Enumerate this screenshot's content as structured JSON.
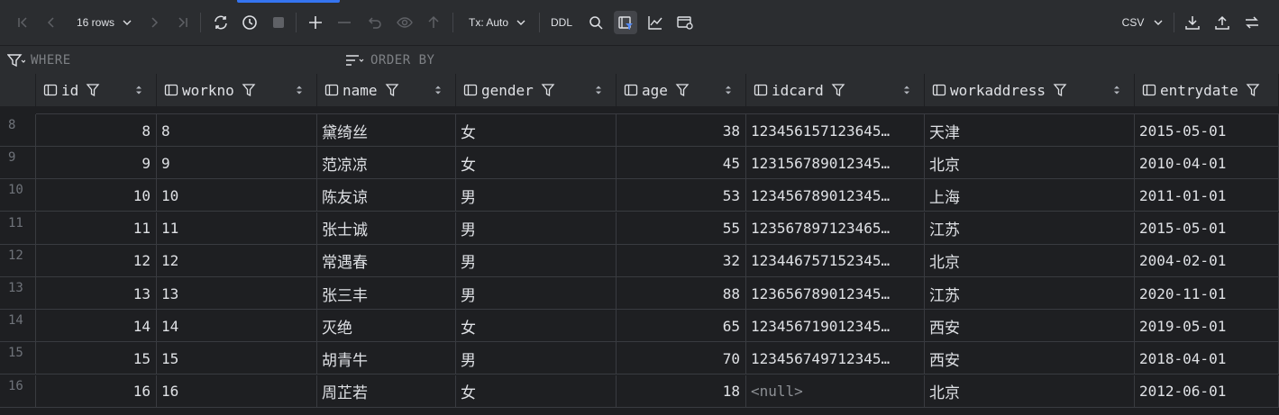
{
  "toolbar": {
    "rows_label": "16 rows",
    "tx_label": "Tx: Auto",
    "ddl_label": "DDL",
    "export_format": "CSV"
  },
  "filter": {
    "where_label": "WHERE",
    "order_label": "ORDER BY"
  },
  "columns": [
    {
      "name": "id"
    },
    {
      "name": "workno"
    },
    {
      "name": "name"
    },
    {
      "name": "gender"
    },
    {
      "name": "age"
    },
    {
      "name": "idcard"
    },
    {
      "name": "workaddress"
    },
    {
      "name": "entrydate"
    }
  ],
  "rows": [
    {
      "num": "8",
      "id": "8",
      "workno": "8",
      "name": "黛绮丝",
      "gender": "女",
      "age": "38",
      "idcard": "123456157123645…",
      "workaddress": "天津",
      "entrydate": "2015-05-01"
    },
    {
      "num": "9",
      "id": "9",
      "workno": "9",
      "name": "范凉凉",
      "gender": "女",
      "age": "45",
      "idcard": "123156789012345…",
      "workaddress": "北京",
      "entrydate": "2010-04-01"
    },
    {
      "num": "10",
      "id": "10",
      "workno": "10",
      "name": "陈友谅",
      "gender": "男",
      "age": "53",
      "idcard": "123456789012345…",
      "workaddress": "上海",
      "entrydate": "2011-01-01"
    },
    {
      "num": "11",
      "id": "11",
      "workno": "11",
      "name": "张士诚",
      "gender": "男",
      "age": "55",
      "idcard": "123567897123465…",
      "workaddress": "江苏",
      "entrydate": "2015-05-01"
    },
    {
      "num": "12",
      "id": "12",
      "workno": "12",
      "name": "常遇春",
      "gender": "男",
      "age": "32",
      "idcard": "123446757152345…",
      "workaddress": "北京",
      "entrydate": "2004-02-01"
    },
    {
      "num": "13",
      "id": "13",
      "workno": "13",
      "name": "张三丰",
      "gender": "男",
      "age": "88",
      "idcard": "123656789012345…",
      "workaddress": "江苏",
      "entrydate": "2020-11-01"
    },
    {
      "num": "14",
      "id": "14",
      "workno": "14",
      "name": "灭绝",
      "gender": "女",
      "age": "65",
      "idcard": "123456719012345…",
      "workaddress": "西安",
      "entrydate": "2019-05-01"
    },
    {
      "num": "15",
      "id": "15",
      "workno": "15",
      "name": "胡青牛",
      "gender": "男",
      "age": "70",
      "idcard": "123456749712345…",
      "workaddress": "西安",
      "entrydate": "2018-04-01"
    },
    {
      "num": "16",
      "id": "16",
      "workno": "16",
      "name": "周芷若",
      "gender": "女",
      "age": "18",
      "idcard": "<null>",
      "workaddress": "北京",
      "entrydate": "2012-06-01"
    }
  ]
}
